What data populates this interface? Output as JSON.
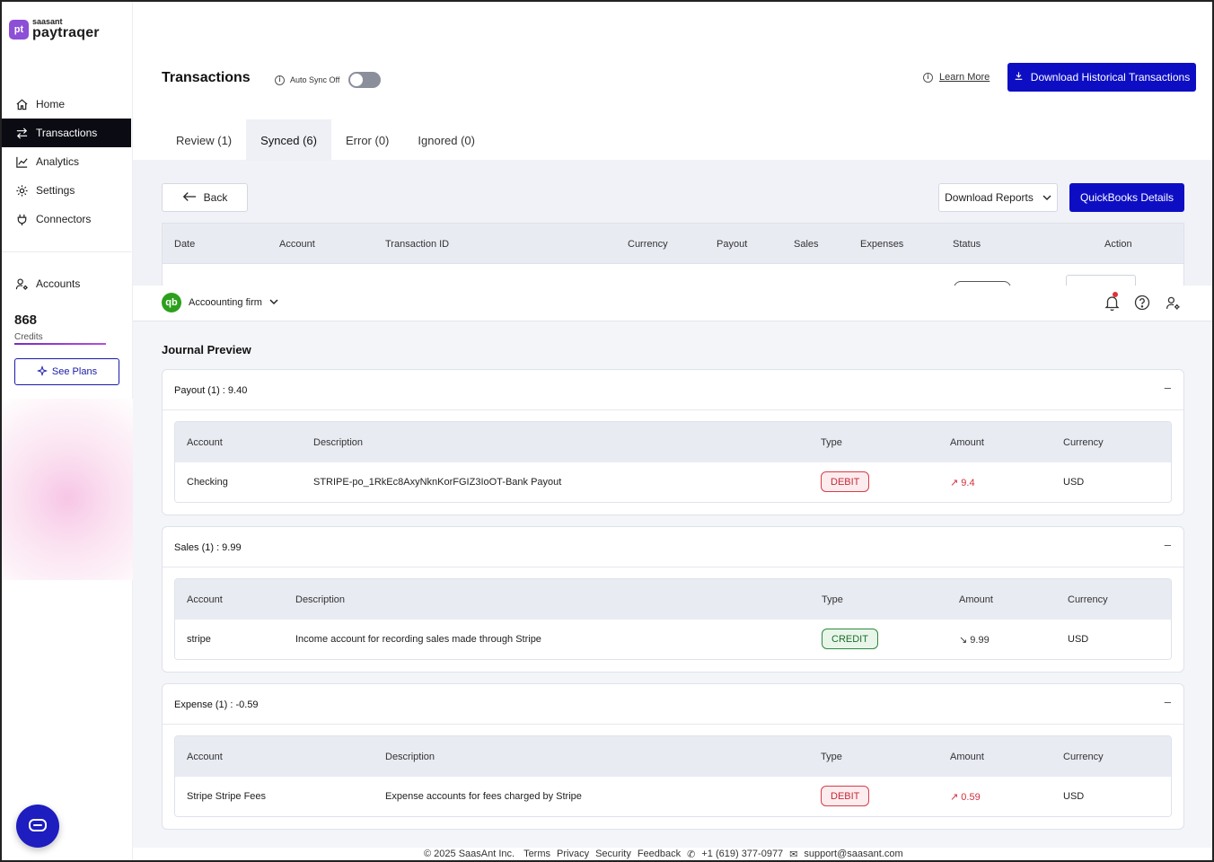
{
  "brand": {
    "company": "saasant",
    "product": "paytraqer",
    "mark": "pt"
  },
  "sidebar": {
    "items": [
      {
        "label": "Home",
        "icon": "home-icon"
      },
      {
        "label": "Transactions",
        "icon": "transfer-icon",
        "active": true
      },
      {
        "label": "Analytics",
        "icon": "chart-line-icon"
      },
      {
        "label": "Settings",
        "icon": "gear-icon"
      },
      {
        "label": "Connectors",
        "icon": "plug-icon"
      }
    ],
    "accounts_label": "Accounts",
    "credits_value": "868",
    "credits_label": "Credits",
    "credits_progress": 1.0,
    "see_plans_label": "See Plans"
  },
  "header": {
    "title": "Transactions",
    "auto_sync_label": "Auto Sync Off",
    "auto_sync_on": false,
    "learn_more_label": "Learn More",
    "download_historical_label": "Download Historical Transactions"
  },
  "tabs": [
    {
      "label": "Review (1)",
      "active": false
    },
    {
      "label": "Synced (6)",
      "active": true
    },
    {
      "label": "Error (0)",
      "active": false
    },
    {
      "label": "Ignored (0)",
      "active": false
    }
  ],
  "toolbar": {
    "back_label": "Back",
    "download_reports_label": "Download Reports",
    "quickbooks_details_label": "QuickBooks Details"
  },
  "transactions_table": {
    "columns": [
      "Date",
      "Account",
      "Transaction ID",
      "Currency",
      "Payout",
      "Sales",
      "Expenses",
      "Status",
      "Action"
    ]
  },
  "panel": {
    "company_name": "Accoounting firm",
    "title": "Journal Preview",
    "sections": [
      {
        "title": "Payout (1) : 9.40",
        "columns": [
          "Account",
          "Description",
          "Type",
          "Amount",
          "Currency"
        ],
        "rows": [
          {
            "account": "Checking",
            "description": "STRIPE-po_1RkEc8AxyNknKorFGIZ3IoOT-Bank Payout",
            "type": "DEBIT",
            "amount": "9.4",
            "currency": "USD"
          }
        ]
      },
      {
        "title": "Sales (1) : 9.99",
        "columns": [
          "Account",
          "Description",
          "Type",
          "Amount",
          "Currency"
        ],
        "rows": [
          {
            "account": "stripe",
            "description": "Income account for recording sales made through Stripe",
            "type": "CREDIT",
            "amount": "9.99",
            "currency": "USD"
          }
        ]
      },
      {
        "title": "Expense (1) : -0.59",
        "columns": [
          "Account",
          "Description",
          "Type",
          "Amount",
          "Currency"
        ],
        "rows": [
          {
            "account": "Stripe Stripe Fees",
            "description": "Expense accounts for fees charged by Stripe",
            "type": "DEBIT",
            "amount": "0.59",
            "currency": "USD"
          }
        ]
      }
    ]
  },
  "footer": {
    "copyright": "© 2025 SaasAnt Inc.",
    "links": [
      "Terms",
      "Privacy",
      "Security",
      "Feedback"
    ],
    "phone": "+1 (619) 377-0977",
    "email": "support@saasant.com"
  },
  "colors": {
    "primary": "#0d0ec4",
    "debit": "#d0303e",
    "credit": "#2c8a3c",
    "quickbooks_green": "#2ca01c",
    "sidebar_active": "#0b0b14"
  }
}
